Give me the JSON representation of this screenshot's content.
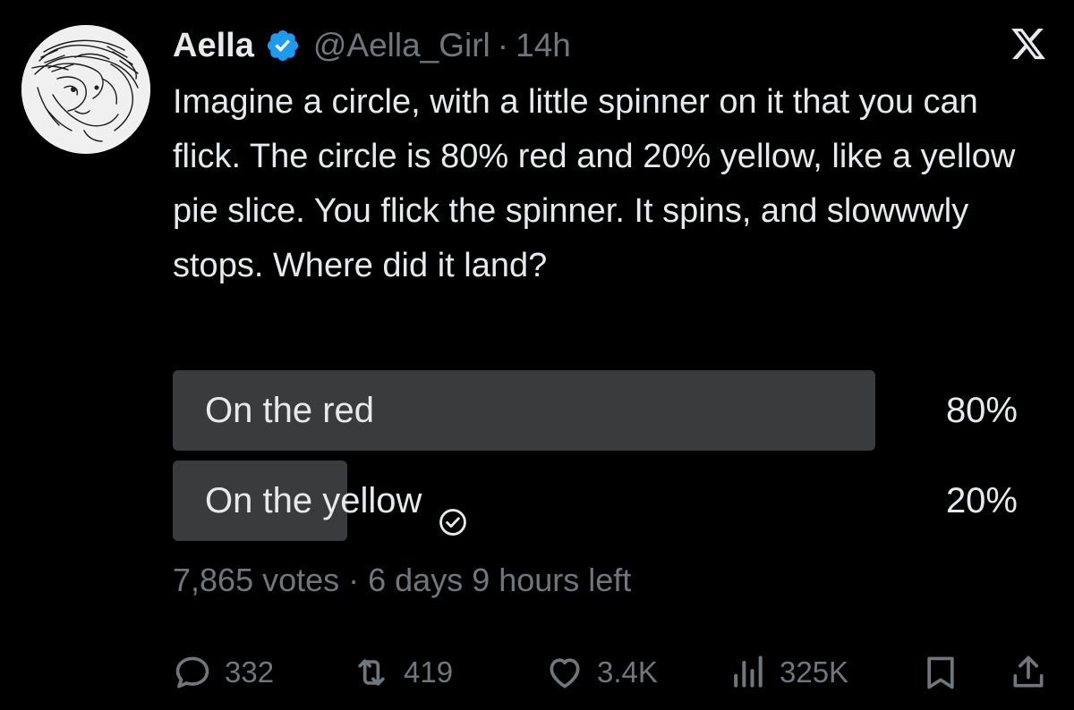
{
  "author": {
    "name": "Aella",
    "handle": "@Aella_Girl",
    "separator": "·",
    "time": "14h",
    "verified": true
  },
  "tweet": {
    "text": "Imagine a circle, with a little spinner on it that you can flick. The circle is 80% red and 20% yellow, like a yellow pie slice. You flick the spinner. It spins, and slowwwly stops.  Where did it land?"
  },
  "poll": {
    "options": [
      {
        "label": "On the red",
        "percent_label": "80%",
        "percent": 80,
        "selected": false
      },
      {
        "label": "On the yellow",
        "percent_label": "20%",
        "percent": 20,
        "selected": true
      }
    ],
    "meta": "7,865 votes · 6 days 9 hours left"
  },
  "actions": {
    "replies": "332",
    "reposts": "419",
    "likes": "3.4K",
    "views": "325K"
  },
  "icons": {
    "verified": "verified-badge-icon",
    "logo": "x-logo-icon",
    "reply": "reply-icon",
    "repost": "repost-icon",
    "like": "heart-icon",
    "views": "views-icon",
    "bookmark": "bookmark-icon",
    "share": "share-icon",
    "vote_check": "check-circle-icon"
  },
  "colors": {
    "background": "#000000",
    "text": "#e7e9ea",
    "muted": "#71767b",
    "poll_bar": "#3a3b3d",
    "verified": "#1d9bf0"
  }
}
